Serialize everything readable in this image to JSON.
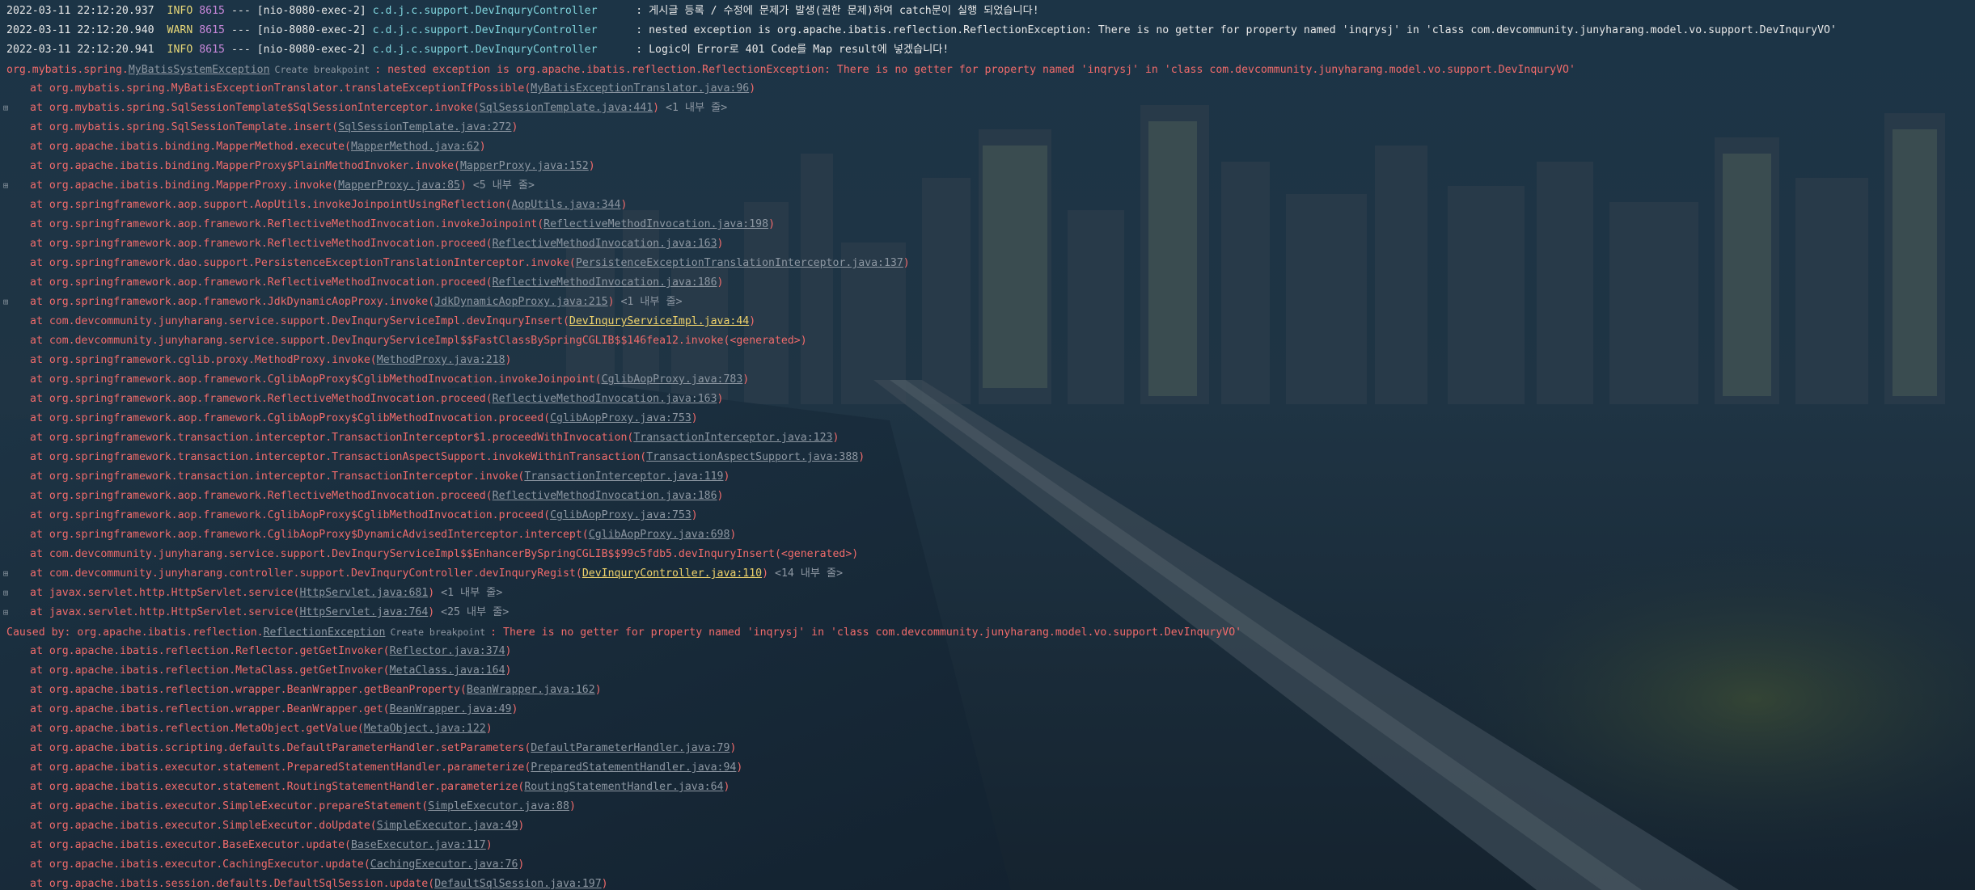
{
  "logs": [
    {
      "timestamp": "2022-03-11 22:12:20.937",
      "level": "INFO",
      "pid": "8615",
      "sep": "---",
      "thread": "[nio-8080-exec-2]",
      "logger": "c.d.j.c.support.DevInquryController     ",
      "message": ": 게시글 등록 / 수정에 문제가 발생(권한 문제)하여 catch문이 실행 되었습니다!"
    },
    {
      "timestamp": "2022-03-11 22:12:20.940",
      "level": "WARN",
      "pid": "8615",
      "sep": "---",
      "thread": "[nio-8080-exec-2]",
      "logger": "c.d.j.c.support.DevInquryController     ",
      "message": ": nested exception is org.apache.ibatis.reflection.ReflectionException: There is no getter for property named 'inqrysj' in 'class com.devcommunity.junyharang.model.vo.support.DevInquryVO'"
    },
    {
      "timestamp": "2022-03-11 22:12:20.941",
      "level": "INFO",
      "pid": "8615",
      "sep": "---",
      "thread": "[nio-8080-exec-2]",
      "logger": "c.d.j.c.support.DevInquryController     ",
      "message": ": Logic이 Error로 401 Code를 Map result에 넣겠습니다!"
    }
  ],
  "exception": {
    "prefix": "org.mybatis.spring.",
    "class_link": "MyBatisSystemException",
    "breakpoint": "Create breakpoint",
    "message": ": nested exception is org.apache.ibatis.reflection.ReflectionException: There is no getter for property named 'inqrysj' in 'class com.devcommunity.junyharang.model.vo.support.DevInquryVO'"
  },
  "frames": [
    {
      "method": "at org.mybatis.spring.MyBatisExceptionTranslator.translateExceptionIfPossible(",
      "loc": "MyBatisExceptionTranslator.java:96",
      "suffix": ")",
      "fold": "",
      "user": false
    },
    {
      "method": "at org.mybatis.spring.SqlSessionTemplate$SqlSessionInterceptor.invoke(",
      "loc": "SqlSessionTemplate.java:441",
      "suffix": ")",
      "fold": " <1 내부 줄>",
      "user": false
    },
    {
      "method": "at org.mybatis.spring.SqlSessionTemplate.insert(",
      "loc": "SqlSessionTemplate.java:272",
      "suffix": ")",
      "fold": "",
      "user": false
    },
    {
      "method": "at org.apache.ibatis.binding.MapperMethod.execute(",
      "loc": "MapperMethod.java:62",
      "suffix": ")",
      "fold": "",
      "user": false
    },
    {
      "method": "at org.apache.ibatis.binding.MapperProxy$PlainMethodInvoker.invoke(",
      "loc": "MapperProxy.java:152",
      "suffix": ")",
      "fold": "",
      "user": false
    },
    {
      "method": "at org.apache.ibatis.binding.MapperProxy.invoke(",
      "loc": "MapperProxy.java:85",
      "suffix": ")",
      "fold": " <5 내부 줄>",
      "user": false
    },
    {
      "method": "at org.springframework.aop.support.AopUtils.invokeJoinpointUsingReflection(",
      "loc": "AopUtils.java:344",
      "suffix": ")",
      "fold": "",
      "user": false
    },
    {
      "method": "at org.springframework.aop.framework.ReflectiveMethodInvocation.invokeJoinpoint(",
      "loc": "ReflectiveMethodInvocation.java:198",
      "suffix": ")",
      "fold": "",
      "user": false
    },
    {
      "method": "at org.springframework.aop.framework.ReflectiveMethodInvocation.proceed(",
      "loc": "ReflectiveMethodInvocation.java:163",
      "suffix": ")",
      "fold": "",
      "user": false
    },
    {
      "method": "at org.springframework.dao.support.PersistenceExceptionTranslationInterceptor.invoke(",
      "loc": "PersistenceExceptionTranslationInterceptor.java:137",
      "suffix": ")",
      "fold": "",
      "user": false
    },
    {
      "method": "at org.springframework.aop.framework.ReflectiveMethodInvocation.proceed(",
      "loc": "ReflectiveMethodInvocation.java:186",
      "suffix": ")",
      "fold": "",
      "user": false
    },
    {
      "method": "at org.springframework.aop.framework.JdkDynamicAopProxy.invoke(",
      "loc": "JdkDynamicAopProxy.java:215",
      "suffix": ")",
      "fold": " <1 내부 줄>",
      "user": false
    },
    {
      "method": "at com.devcommunity.junyharang.service.support.DevInquryServiceImpl.devInquryInsert(",
      "loc": "DevInquryServiceImpl.java:44",
      "suffix": ")",
      "fold": "",
      "user": true
    },
    {
      "method": "at com.devcommunity.junyharang.service.support.DevInquryServiceImpl$$FastClassBySpringCGLIB$$146fea12.invoke(<generated>)",
      "loc": "",
      "suffix": "",
      "fold": "",
      "user": false
    },
    {
      "method": "at org.springframework.cglib.proxy.MethodProxy.invoke(",
      "loc": "MethodProxy.java:218",
      "suffix": ")",
      "fold": "",
      "user": false
    },
    {
      "method": "at org.springframework.aop.framework.CglibAopProxy$CglibMethodInvocation.invokeJoinpoint(",
      "loc": "CglibAopProxy.java:783",
      "suffix": ")",
      "fold": "",
      "user": false
    },
    {
      "method": "at org.springframework.aop.framework.ReflectiveMethodInvocation.proceed(",
      "loc": "ReflectiveMethodInvocation.java:163",
      "suffix": ")",
      "fold": "",
      "user": false
    },
    {
      "method": "at org.springframework.aop.framework.CglibAopProxy$CglibMethodInvocation.proceed(",
      "loc": "CglibAopProxy.java:753",
      "suffix": ")",
      "fold": "",
      "user": false
    },
    {
      "method": "at org.springframework.transaction.interceptor.TransactionInterceptor$1.proceedWithInvocation(",
      "loc": "TransactionInterceptor.java:123",
      "suffix": ")",
      "fold": "",
      "user": false
    },
    {
      "method": "at org.springframework.transaction.interceptor.TransactionAspectSupport.invokeWithinTransaction(",
      "loc": "TransactionAspectSupport.java:388",
      "suffix": ")",
      "fold": "",
      "user": false
    },
    {
      "method": "at org.springframework.transaction.interceptor.TransactionInterceptor.invoke(",
      "loc": "TransactionInterceptor.java:119",
      "suffix": ")",
      "fold": "",
      "user": false
    },
    {
      "method": "at org.springframework.aop.framework.ReflectiveMethodInvocation.proceed(",
      "loc": "ReflectiveMethodInvocation.java:186",
      "suffix": ")",
      "fold": "",
      "user": false
    },
    {
      "method": "at org.springframework.aop.framework.CglibAopProxy$CglibMethodInvocation.proceed(",
      "loc": "CglibAopProxy.java:753",
      "suffix": ")",
      "fold": "",
      "user": false
    },
    {
      "method": "at org.springframework.aop.framework.CglibAopProxy$DynamicAdvisedInterceptor.intercept(",
      "loc": "CglibAopProxy.java:698",
      "suffix": ")",
      "fold": "",
      "user": false
    },
    {
      "method": "at com.devcommunity.junyharang.service.support.DevInquryServiceImpl$$EnhancerBySpringCGLIB$$99c5fdb5.devInquryInsert(<generated>)",
      "loc": "",
      "suffix": "",
      "fold": "",
      "user": false
    },
    {
      "method": "at com.devcommunity.junyharang.controller.support.DevInquryController.devInquryRegist(",
      "loc": "DevInquryController.java:110",
      "suffix": ")",
      "fold": " <14 내부 줄>",
      "user": true
    },
    {
      "method": "at javax.servlet.http.HttpServlet.service(",
      "loc": "HttpServlet.java:681",
      "suffix": ")",
      "fold": " <1 내부 줄>",
      "user": false
    },
    {
      "method": "at javax.servlet.http.HttpServlet.service(",
      "loc": "HttpServlet.java:764",
      "suffix": ")",
      "fold": " <25 내부 줄>",
      "user": false
    }
  ],
  "caused_by": {
    "prefix": "Caused by: org.apache.ibatis.reflection.",
    "class_link": "ReflectionException",
    "breakpoint": "Create breakpoint",
    "message": ": There is no getter for property named 'inqrysj' in 'class com.devcommunity.junyharang.model.vo.support.DevInquryVO'"
  },
  "caused_frames": [
    {
      "method": "at org.apache.ibatis.reflection.Reflector.getGetInvoker(",
      "loc": "Reflector.java:374",
      "suffix": ")",
      "fold": "",
      "user": false
    },
    {
      "method": "at org.apache.ibatis.reflection.MetaClass.getGetInvoker(",
      "loc": "MetaClass.java:164",
      "suffix": ")",
      "fold": "",
      "user": false
    },
    {
      "method": "at org.apache.ibatis.reflection.wrapper.BeanWrapper.getBeanProperty(",
      "loc": "BeanWrapper.java:162",
      "suffix": ")",
      "fold": "",
      "user": false
    },
    {
      "method": "at org.apache.ibatis.reflection.wrapper.BeanWrapper.get(",
      "loc": "BeanWrapper.java:49",
      "suffix": ")",
      "fold": "",
      "user": false
    },
    {
      "method": "at org.apache.ibatis.reflection.MetaObject.getValue(",
      "loc": "MetaObject.java:122",
      "suffix": ")",
      "fold": "",
      "user": false
    },
    {
      "method": "at org.apache.ibatis.scripting.defaults.DefaultParameterHandler.setParameters(",
      "loc": "DefaultParameterHandler.java:79",
      "suffix": ")",
      "fold": "",
      "user": false
    },
    {
      "method": "at org.apache.ibatis.executor.statement.PreparedStatementHandler.parameterize(",
      "loc": "PreparedStatementHandler.java:94",
      "suffix": ")",
      "fold": "",
      "user": false
    },
    {
      "method": "at org.apache.ibatis.executor.statement.RoutingStatementHandler.parameterize(",
      "loc": "RoutingStatementHandler.java:64",
      "suffix": ")",
      "fold": "",
      "user": false
    },
    {
      "method": "at org.apache.ibatis.executor.SimpleExecutor.prepareStatement(",
      "loc": "SimpleExecutor.java:88",
      "suffix": ")",
      "fold": "",
      "user": false
    },
    {
      "method": "at org.apache.ibatis.executor.SimpleExecutor.doUpdate(",
      "loc": "SimpleExecutor.java:49",
      "suffix": ")",
      "fold": "",
      "user": false
    },
    {
      "method": "at org.apache.ibatis.executor.BaseExecutor.update(",
      "loc": "BaseExecutor.java:117",
      "suffix": ")",
      "fold": "",
      "user": false
    },
    {
      "method": "at org.apache.ibatis.executor.CachingExecutor.update(",
      "loc": "CachingExecutor.java:76",
      "suffix": ")",
      "fold": "",
      "user": false
    },
    {
      "method": "at org.apache.ibatis.session.defaults.DefaultSqlSession.update(",
      "loc": "DefaultSqlSession.java:197",
      "suffix": ")",
      "fold": "",
      "user": false
    }
  ],
  "colors": {
    "background": "#1b2d3c",
    "error": "#f06b6b",
    "link": "#8d97a2",
    "user_link": "#f0d36b",
    "info": "#e9d878",
    "logger": "#7fd3dc"
  }
}
